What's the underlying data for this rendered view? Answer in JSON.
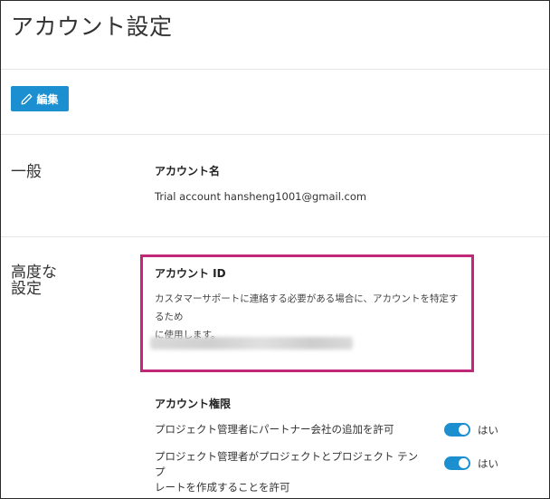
{
  "header": {
    "title": "アカウント設定"
  },
  "toolbar": {
    "edit_label": "編集"
  },
  "general": {
    "section_label": "一般",
    "account_name_label": "アカウント名",
    "account_name_value": "Trial account hansheng1001@gmail.com"
  },
  "advanced": {
    "section_label_line1": "高度な",
    "section_label_line2": "設定",
    "account_id_label": "アカウント ID",
    "account_id_desc_line1": "カスタマーサポートに連絡する必要がある場合に、アカウントを特定するため",
    "account_id_desc_line2": "に使用します。",
    "permissions_label": "アカウント権限",
    "permissions": [
      {
        "text_line1": "プロジェクト管理者にパートナー会社の追加を許可",
        "text_line2": "",
        "toggle_label": "はい",
        "enabled": true
      },
      {
        "text_line1": "プロジェクト管理者がプロジェクトとプロジェクト テンプ",
        "text_line2": "レートを作成することを許可",
        "toggle_label": "はい",
        "enabled": true
      }
    ]
  },
  "colors": {
    "accent": "#1b8fcf",
    "highlight": "#c0287a"
  }
}
